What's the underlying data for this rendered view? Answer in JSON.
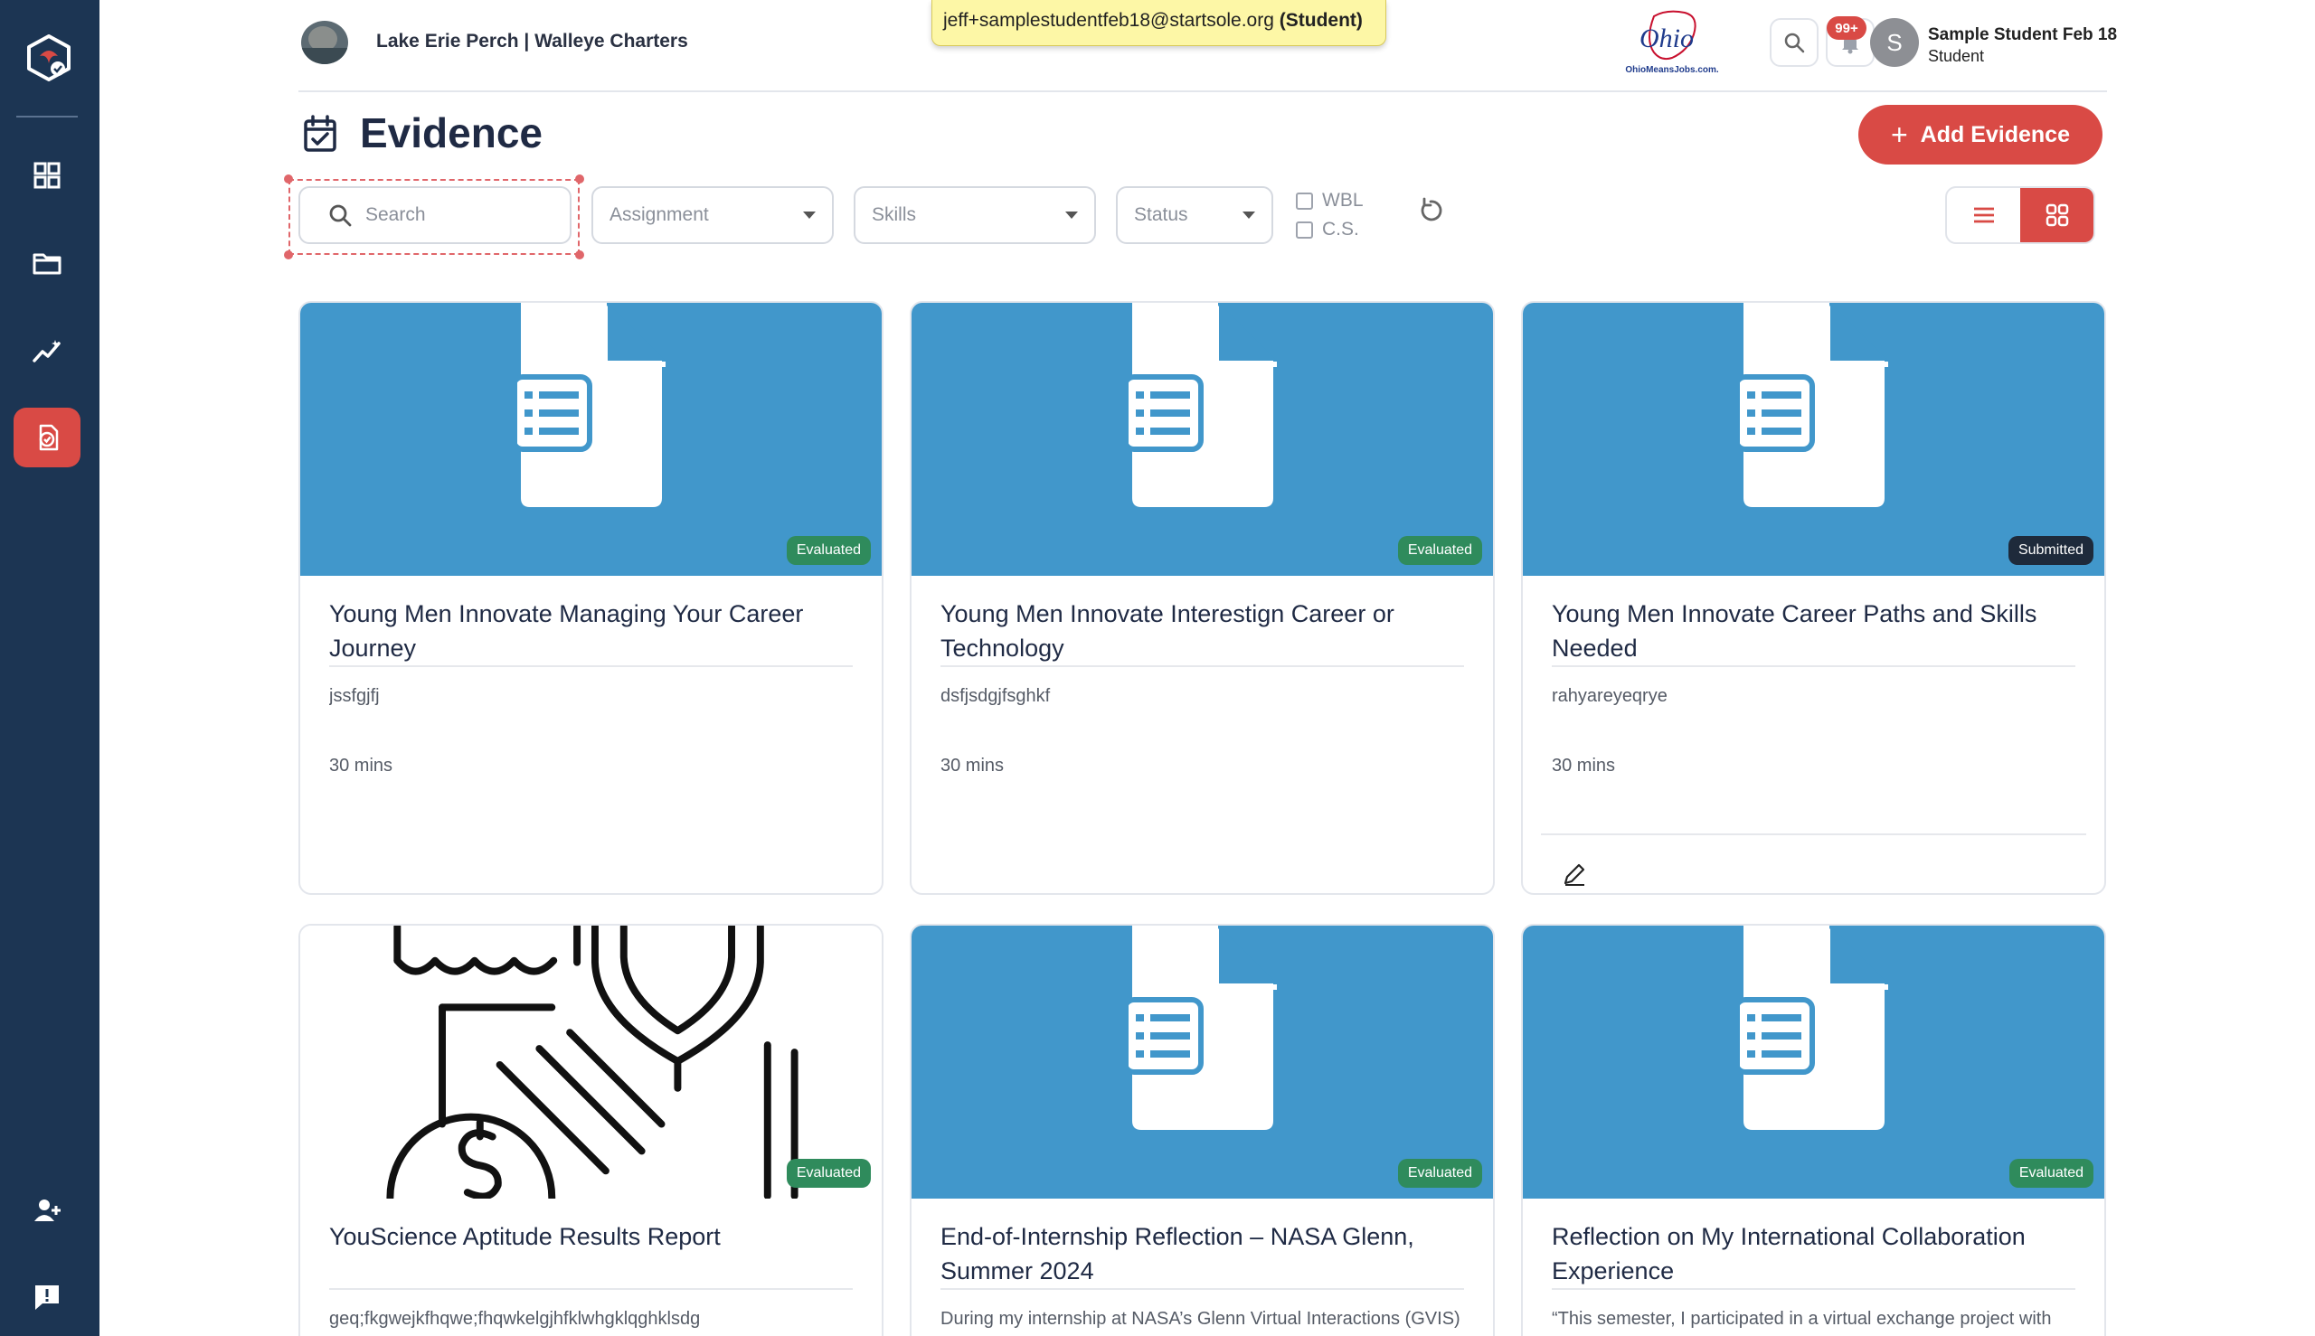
{
  "header": {
    "org_name": "Lake Erie Perch | Walleye Charters",
    "impersonation_email": "jeff+samplestudentfeb18@startsole.org",
    "impersonation_role": "(Student)",
    "ohio_logo_word": "Ohio",
    "ohio_logo_tagline": "OhioMeansJobs.com.",
    "notification_count": "99+",
    "user_initial": "S",
    "user_name": "Sample Student Feb 18",
    "user_role": "Student"
  },
  "sidebar": {
    "items": [
      {
        "icon": "dashboard-icon"
      },
      {
        "icon": "folder-icon"
      },
      {
        "icon": "analytics-icon"
      },
      {
        "icon": "evidence-icon",
        "active": true
      },
      {
        "icon": "add-user-icon"
      },
      {
        "icon": "feedback-icon"
      }
    ]
  },
  "page": {
    "title": "Evidence",
    "add_button_label": "Add Evidence"
  },
  "filters": {
    "search_placeholder": "Search",
    "assignment_placeholder": "Assignment",
    "skills_placeholder": "Skills",
    "status_placeholder": "Status",
    "wbl_label": "WBL",
    "cs_label": "C.S."
  },
  "cards": [
    {
      "title": "Young Men Innovate Managing Your Career Journey",
      "description": "jssfgjfj",
      "duration": "30 mins",
      "status": "Evaluated"
    },
    {
      "title": "Young Men Innovate Interestign Career or Technology",
      "description": "dsfjsdgjfsghkf",
      "duration": "30 mins",
      "status": "Evaluated"
    },
    {
      "title": "Young Men Innovate Career Paths and Skills Needed",
      "description": "rahyareyeqrye",
      "duration": "30 mins",
      "status": "Submitted"
    },
    {
      "title": "YouScience Aptitude Results Report",
      "description": "geq;fkgwejkfhqwe;fhqwkelgjhfklwhgklqghklsdg",
      "status": "Evaluated"
    },
    {
      "title": "End-of-Internship Reflection – NASA Glenn, Summer 2024",
      "description": "During my internship at NASA’s Glenn Virtual Interactions (GVIS) Lab, I was tasked with developing a 3D visualizatio",
      "status": "Evaluated"
    },
    {
      "title": "Reflection on My International Collaboration Experience",
      "description": "“This semester, I participated in a virtual exchange project with students from Argentina and Japan. At first, I assum",
      "status": "Evaluated"
    }
  ],
  "colors": {
    "sidebar_bg": "#1c3553",
    "accent": "#d94a45",
    "thumb_blue": "#4197cb",
    "evaluated_green": "#2f8b5c",
    "submitted_dark": "#1e2a3b",
    "tooltip_yellow": "#fdf7a6"
  }
}
